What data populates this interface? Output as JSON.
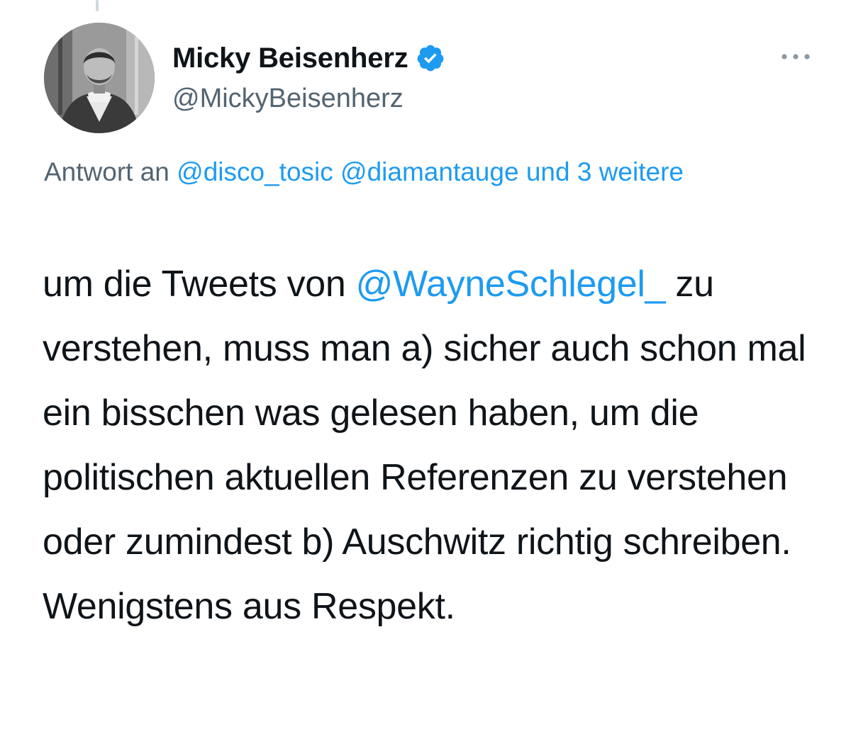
{
  "author": {
    "display_name": "Micky Beisenherz",
    "handle": "@MickyBeisenherz",
    "verified": true
  },
  "more_button_icon": "more-horizontal-icon",
  "reply_context": {
    "prefix": "Antwort an",
    "mention_1": "@disco_tosic",
    "mention_2": "@diamantauge",
    "suffix": "und 3 weitere"
  },
  "tweet": {
    "text_before_mention": "um die Tweets von ",
    "mention": "@WayneSchlegel_",
    "text_after_mention": " zu verstehen, muss man a) sicher auch schon mal ein bisschen was gelesen haben, um die politischen aktuellen Referenzen zu verstehen oder zumindest b) Auschwitz richtig schreiben. Wenigstens aus Respekt."
  },
  "colors": {
    "link": "#1d9bf0",
    "secondary_text": "#536471",
    "primary_text": "#0f1419",
    "verified_badge": "#1d9bf0"
  }
}
